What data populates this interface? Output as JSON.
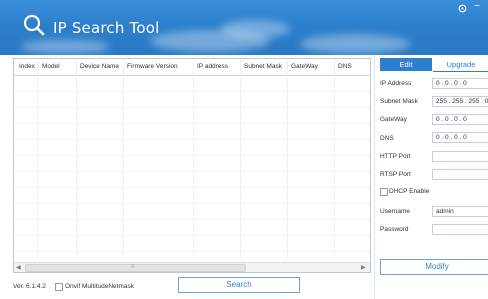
{
  "header": {
    "title": "IP Search Tool",
    "settings_icon": "settings-icon",
    "minimize_label": "−"
  },
  "table": {
    "columns": [
      "Index",
      "Model",
      "Device Name",
      "Firmware Version",
      "IP address",
      "Subnet Mask",
      "GateWay",
      "DNS"
    ],
    "rows": []
  },
  "footer": {
    "version": "Ver. 6.1.4.2",
    "onvif_label": "Onvif MultitudeNetmask",
    "search_label": "Search"
  },
  "panel": {
    "tabs": [
      "Edit",
      "Upgrade"
    ],
    "active_tab": "Edit",
    "fields": {
      "ip_address": {
        "label": "IP Address",
        "value": "0 . 0 . 0 . 0"
      },
      "subnet_mask": {
        "label": "Subnet Mask",
        "value": "255 . 255 . 255 . 0"
      },
      "gateway": {
        "label": "GateWay",
        "value": "0 . 0 . 0 . 0"
      },
      "dns": {
        "label": "DNS",
        "value": "0 . 0 . 0 . 0"
      },
      "http_port": {
        "label": "HTTP Port",
        "value": ""
      },
      "rtsp_port": {
        "label": "RTSP Port",
        "value": ""
      },
      "dhcp": {
        "label": "DHCP Enable"
      },
      "username": {
        "label": "Username",
        "value": "admin"
      },
      "password": {
        "label": "Password",
        "value": ""
      }
    },
    "modify_label": "Modify"
  },
  "colors": {
    "header_blue": "#2c7fcc",
    "accent_blue": "#2e7fd0"
  }
}
